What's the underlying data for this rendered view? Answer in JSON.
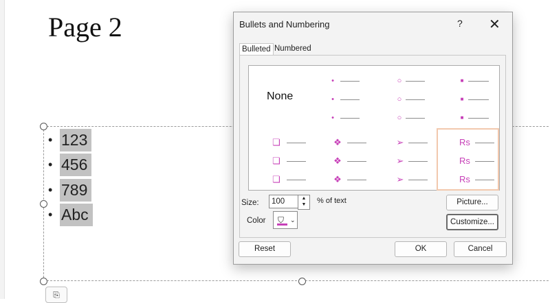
{
  "slide": {
    "title": "Page 2",
    "bullet_char": "•",
    "bullets": [
      "123",
      "456",
      "789",
      "Abc"
    ],
    "paste_icon": "paste-options-icon"
  },
  "dialog": {
    "title": "Bullets and Numbering",
    "help": "?",
    "close": "✕",
    "tabs": [
      "Bulleted",
      "Numbered"
    ],
    "active_tab": "Bulleted",
    "gallery": {
      "none_label": "None",
      "styles": [
        {
          "name": "small-dot",
          "glyph": "•"
        },
        {
          "name": "hollow-circle",
          "glyph": "○"
        },
        {
          "name": "filled-square",
          "glyph": "■"
        },
        {
          "name": "hollow-square-3d",
          "glyph": "❏"
        },
        {
          "name": "four-diamond",
          "glyph": "❖"
        },
        {
          "name": "arrowhead",
          "glyph": "➢"
        },
        {
          "name": "checkmark",
          "glyph": "Rs"
        }
      ],
      "selected": "checkmark",
      "bullet_color": "#c740b8"
    },
    "size_label": "Size:",
    "size_value": "100",
    "percent_label": "% of text",
    "color_label": "Color",
    "color_value": "#c740b8",
    "buttons": {
      "picture": "Picture...",
      "customize": "Customize...",
      "reset": "Reset",
      "ok": "OK",
      "cancel": "Cancel"
    }
  }
}
